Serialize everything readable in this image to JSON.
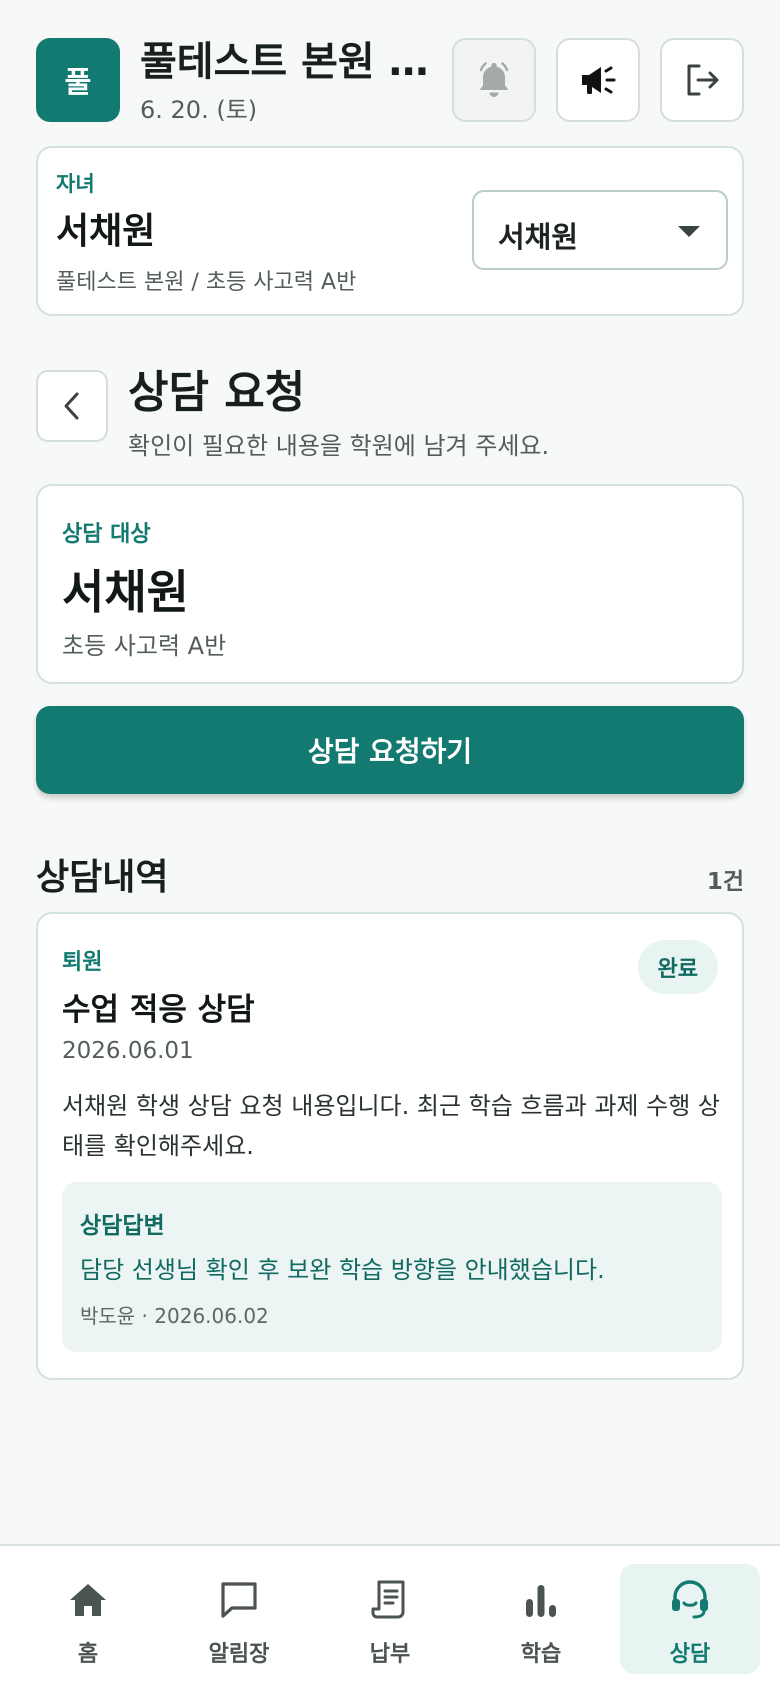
{
  "header": {
    "logo_letter": "풀",
    "academy_name": "풀테스트 본원 학원",
    "date": "6. 20. (토)",
    "icons": [
      "bell-icon",
      "megaphone-icon",
      "logout-icon"
    ]
  },
  "child_card": {
    "label": "자녀",
    "name": "서채원",
    "class_info": "풀테스트 본원 / 초등 사고력 A반",
    "selected_child": "서채원"
  },
  "page": {
    "title": "상담 요청",
    "subtitle": "확인이 필요한 내용을 학원에 남겨 주세요."
  },
  "target": {
    "label": "상담 대상",
    "name": "서채원",
    "class_name": "초등 사고력 A반"
  },
  "request_button_label": "상담 요청하기",
  "history": {
    "title": "상담내역",
    "count": "1건",
    "items": [
      {
        "category": "퇴원",
        "status": "완료",
        "title": "수업 적응 상담",
        "date": "2026.06.01",
        "body": "서채원 학생 상담 요청 내용입니다. 최근 학습 흐름과 과제 수행 상태를 확인해주세요.",
        "answer_label": "상담답변",
        "answer_text": "담당 선생님 확인 후 보완 학습 방향을 안내했습니다.",
        "answer_meta": "박도윤 · 2026.06.02"
      }
    ]
  },
  "nav": {
    "items": [
      {
        "label": "홈",
        "icon": "home-icon"
      },
      {
        "label": "알림장",
        "icon": "chat-icon"
      },
      {
        "label": "납부",
        "icon": "receipt-icon"
      },
      {
        "label": "학습",
        "icon": "bar-chart-icon"
      },
      {
        "label": "상담",
        "icon": "headset-icon"
      }
    ],
    "active": "상담"
  },
  "colors": {
    "brand": "#127a70",
    "background": "#f6f9f8",
    "answer_background": "#ecf5f3"
  }
}
